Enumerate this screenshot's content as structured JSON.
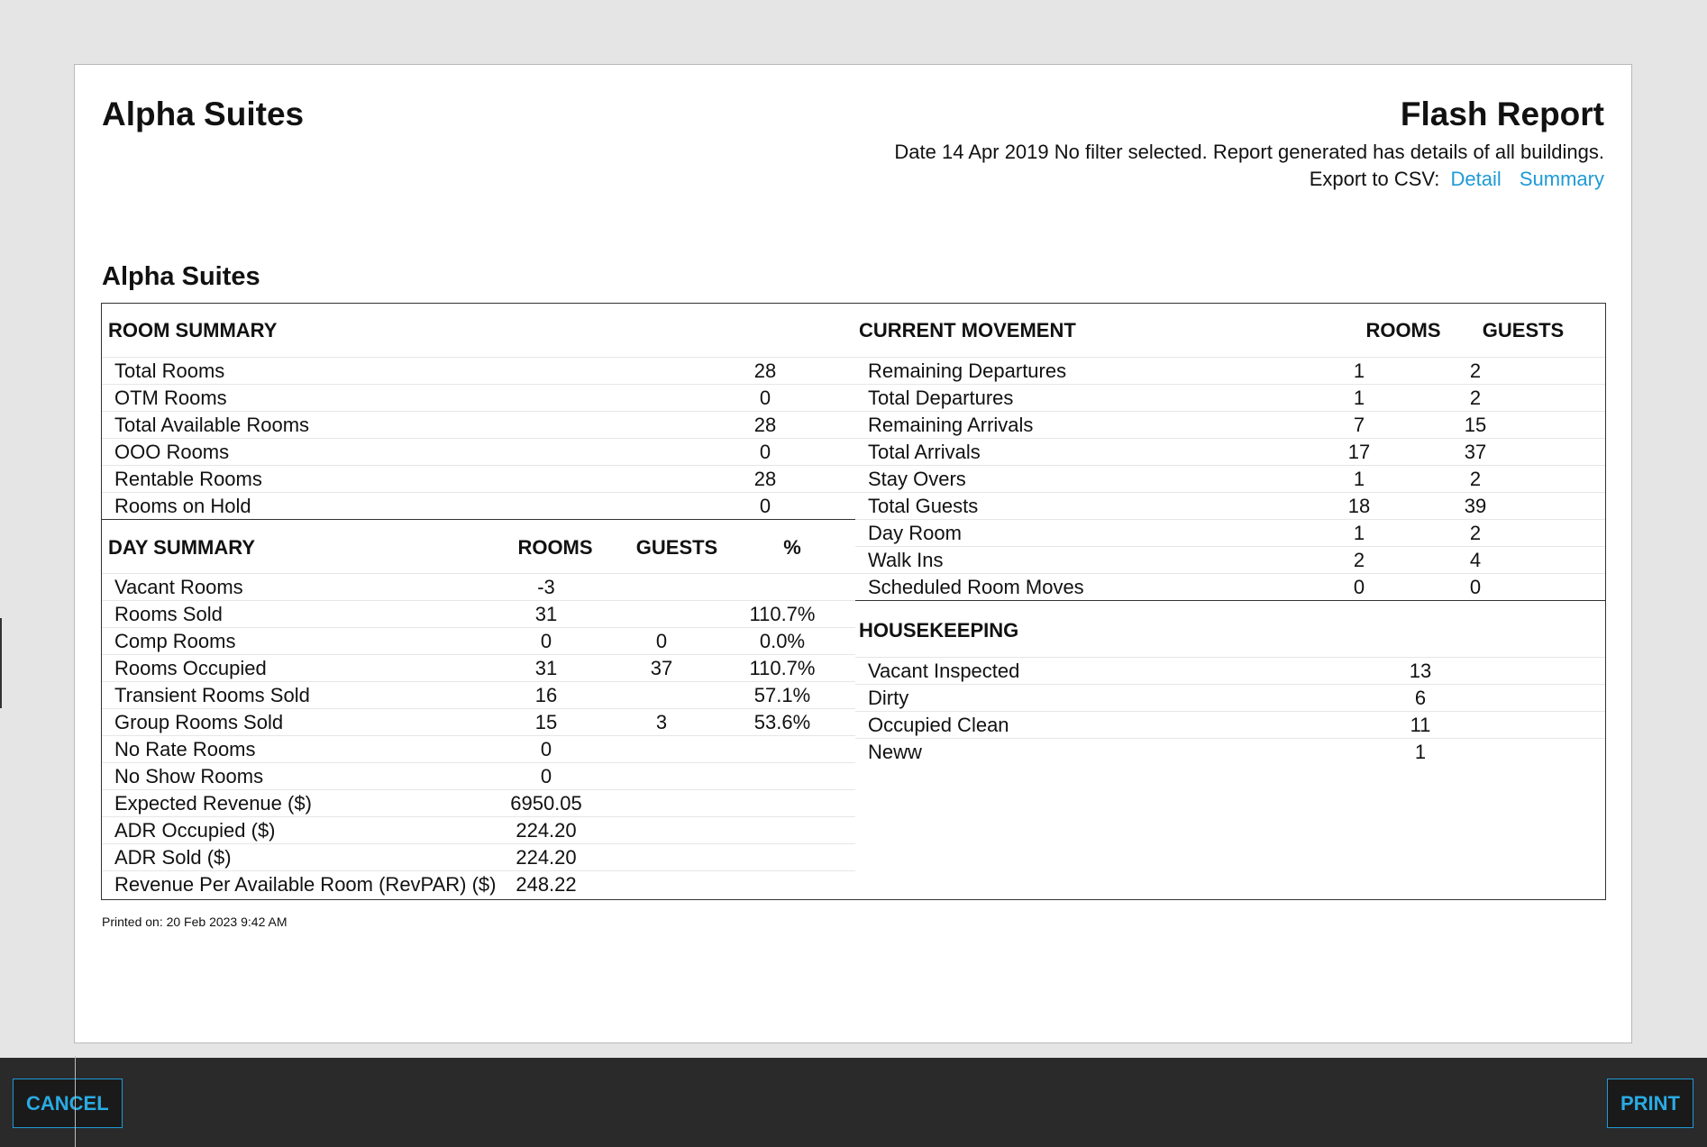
{
  "header": {
    "hotel_name": "Alpha Suites",
    "report_title": "Flash Report",
    "description": "Date 14 Apr 2019 No filter selected. Report generated has details of all buildings.",
    "export_label": "Export to CSV:",
    "export_links": [
      "Detail",
      "Summary"
    ]
  },
  "section_title": "Alpha Suites",
  "room_summary": {
    "title": "ROOM SUMMARY",
    "rows": [
      {
        "label": "Total Rooms",
        "value": "28"
      },
      {
        "label": "OTM Rooms",
        "value": "0"
      },
      {
        "label": "Total Available Rooms",
        "value": "28"
      },
      {
        "label": "OOO Rooms",
        "value": "0"
      },
      {
        "label": "Rentable Rooms",
        "value": "28"
      },
      {
        "label": "Rooms on Hold",
        "value": "0"
      }
    ]
  },
  "day_summary": {
    "title": "DAY SUMMARY",
    "columns": [
      "ROOMS",
      "GUESTS",
      "%"
    ],
    "rows": [
      {
        "label": "Vacant Rooms",
        "rooms": "-3",
        "guests": "",
        "pct": ""
      },
      {
        "label": "Rooms Sold",
        "rooms": "31",
        "guests": "",
        "pct": "110.7%"
      },
      {
        "label": "Comp Rooms",
        "rooms": "0",
        "guests": "0",
        "pct": "0.0%"
      },
      {
        "label": "Rooms Occupied",
        "rooms": "31",
        "guests": "37",
        "pct": "110.7%"
      },
      {
        "label": "Transient Rooms Sold",
        "rooms": "16",
        "guests": "",
        "pct": "57.1%"
      },
      {
        "label": "Group Rooms Sold",
        "rooms": "15",
        "guests": "3",
        "pct": "53.6%"
      },
      {
        "label": "No Rate Rooms",
        "rooms": "0",
        "guests": "",
        "pct": ""
      },
      {
        "label": "No Show Rooms",
        "rooms": "0",
        "guests": "",
        "pct": ""
      },
      {
        "label": "Expected Revenue ($)",
        "rooms": "6950.05",
        "guests": "",
        "pct": ""
      },
      {
        "label": "ADR Occupied ($)",
        "rooms": "224.20",
        "guests": "",
        "pct": ""
      },
      {
        "label": "ADR Sold ($)",
        "rooms": "224.20",
        "guests": "",
        "pct": ""
      },
      {
        "label": "Revenue Per Available Room (RevPAR) ($)",
        "rooms": "248.22",
        "guests": "",
        "pct": ""
      }
    ]
  },
  "current_movement": {
    "title": "CURRENT MOVEMENT",
    "columns": [
      "ROOMS",
      "GUESTS"
    ],
    "rows": [
      {
        "label": "Remaining Departures",
        "rooms": "1",
        "guests": "2"
      },
      {
        "label": "Total Departures",
        "rooms": "1",
        "guests": "2"
      },
      {
        "label": "Remaining Arrivals",
        "rooms": "7",
        "guests": "15"
      },
      {
        "label": "Total Arrivals",
        "rooms": "17",
        "guests": "37"
      },
      {
        "label": "Stay Overs",
        "rooms": "1",
        "guests": "2"
      },
      {
        "label": "Total Guests",
        "rooms": "18",
        "guests": "39"
      },
      {
        "label": "Day Room",
        "rooms": "1",
        "guests": "2"
      },
      {
        "label": "Walk Ins",
        "rooms": "2",
        "guests": "4"
      },
      {
        "label": "Scheduled Room Moves",
        "rooms": "0",
        "guests": "0"
      }
    ]
  },
  "housekeeping": {
    "title": "HOUSEKEEPING",
    "rows": [
      {
        "label": "Vacant Inspected",
        "value": "13"
      },
      {
        "label": "Dirty",
        "value": "6"
      },
      {
        "label": "Occupied Clean",
        "value": "11"
      },
      {
        "label": "Neww",
        "value": "1"
      }
    ]
  },
  "footer_note": "Printed on: 20 Feb 2023 9:42 AM",
  "actions": {
    "cancel": "CANCEL",
    "print": "PRINT"
  },
  "colors": {
    "accent": "#1e9ad6",
    "bar": "#2a2a2a",
    "background": "#e5e5e5"
  }
}
